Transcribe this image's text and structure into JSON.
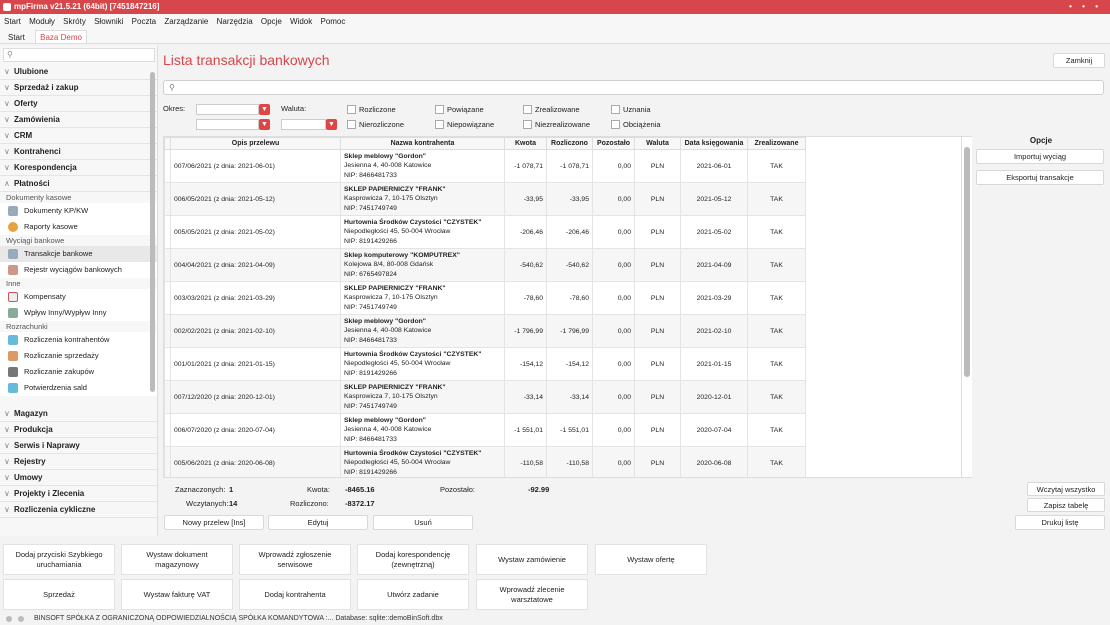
{
  "app": {
    "title": "mpFirma v21.5.21 (64bit) [7451847216]",
    "window_controls": "• • •"
  },
  "menu": [
    "Start",
    "Moduły",
    "Skróty",
    "Słowniki",
    "Poczta",
    "Zarządzanie",
    "Narzędzia",
    "Opcje",
    "Widok",
    "Pomoc"
  ],
  "tabs": [
    {
      "label": "Start"
    },
    {
      "label": "Baza Demo"
    }
  ],
  "sidebar": {
    "search_placeholder": "",
    "sections": [
      {
        "label": "Ulubione"
      },
      {
        "label": "Sprzedaż i zakup"
      },
      {
        "label": "Oferty"
      },
      {
        "label": "Zamówienia"
      },
      {
        "label": "CRM"
      },
      {
        "label": "Kontrahenci"
      },
      {
        "label": "Korespondencja"
      },
      {
        "label": "Płatności"
      }
    ],
    "groups": [
      {
        "label": "Dokumenty kasowe",
        "items": [
          "Dokumenty KP/KW",
          "Raporty kasowe"
        ]
      },
      {
        "label": "Wyciągi bankowe",
        "items": [
          "Transakcje bankowe",
          "Rejestr wyciągów bankowych"
        ]
      },
      {
        "label": "Inne",
        "items": [
          "Kompensaty",
          "Wpływ Inny/Wypływ Inny"
        ]
      },
      {
        "label": "Rozrachunki",
        "items": [
          "Rozliczenia kontrahentów",
          "Rozliczanie sprzedaży",
          "Rozliczanie zakupów",
          "Potwierdzenia sald"
        ]
      }
    ],
    "sections_bottom": [
      {
        "label": "Magazyn"
      },
      {
        "label": "Produkcja"
      },
      {
        "label": "Serwis i Naprawy"
      },
      {
        "label": "Rejestry"
      },
      {
        "label": "Umowy"
      },
      {
        "label": "Projekty i Zlecenia"
      },
      {
        "label": "Rozliczenia cykliczne"
      }
    ]
  },
  "page": {
    "title": "Lista transakcji bankowych",
    "close_label": "Zamknij",
    "search_placeholder": "",
    "filters": {
      "okres_label": "Okres:",
      "waluta_label": "Waluta:",
      "okres_from": "",
      "okres_to": "",
      "waluta_value": "",
      "waluta_value2": "",
      "checkboxes": [
        "Rozliczone",
        "Nierozliczone",
        "Powiązane",
        "Niepowiązane",
        "Zrealizowane",
        "Niezrealizowane",
        "Uznania",
        "Obciążenia"
      ]
    }
  },
  "table": {
    "columns": [
      "Opis przelewu",
      "Nazwa kontrahenta",
      "Kwota",
      "Rozliczono",
      "Pozostało",
      "Waluta",
      "Data księgowania",
      "Zrealizowane"
    ],
    "rows": [
      {
        "opis": "007/06/2021 (z dnia: 2021-06-01)",
        "name": "Sklep meblowy \"Gordon\"",
        "addr": "Jesienna 4, 40-008 Katowice",
        "nip": "NIP: 8466481733",
        "kwota": "-1 078,71",
        "rozl": "-1 078,71",
        "poz": "0,00",
        "waluta": "PLN",
        "data": "2021-06-01",
        "zreal": "TAK"
      },
      {
        "opis": "006/05/2021 (z dnia: 2021-05-12)",
        "name": "SKLEP PAPIERNICZY \"FRANK\"",
        "addr": "Kasprowicza 7, 10-175 Olsztyn",
        "nip": "NIP: 7451749749",
        "kwota": "-33,95",
        "rozl": "-33,95",
        "poz": "0,00",
        "waluta": "PLN",
        "data": "2021-05-12",
        "zreal": "TAK"
      },
      {
        "opis": "005/05/2021 (z dnia: 2021-05-02)",
        "name": "Hurtownia Środków Czystości \"CZYSTEK\"",
        "addr": "Niepodległości 45, 50-004 Wrocław",
        "nip": "NIP: 8191429266",
        "kwota": "-206,46",
        "rozl": "-206,46",
        "poz": "0,00",
        "waluta": "PLN",
        "data": "2021-05-02",
        "zreal": "TAK"
      },
      {
        "opis": "004/04/2021 (z dnia: 2021-04-09)",
        "name": "Sklep komputerowy \"KOMPUTREX\"",
        "addr": "Kolejowa 8/4, 80-008 Gdańsk",
        "nip": "NIP: 6765497824",
        "kwota": "-540,62",
        "rozl": "-540,62",
        "poz": "0,00",
        "waluta": "PLN",
        "data": "2021-04-09",
        "zreal": "TAK"
      },
      {
        "opis": "003/03/2021 (z dnia: 2021-03-29)",
        "name": "SKLEP PAPIERNICZY \"FRANK\"",
        "addr": "Kasprowicza 7, 10-175 Olsztyn",
        "nip": "NIP: 7451749749",
        "kwota": "-78,60",
        "rozl": "-78,60",
        "poz": "0,00",
        "waluta": "PLN",
        "data": "2021-03-29",
        "zreal": "TAK"
      },
      {
        "opis": "002/02/2021 (z dnia: 2021-02-10)",
        "name": "Sklep meblowy \"Gordon\"",
        "addr": "Jesienna 4, 40-008 Katowice",
        "nip": "NIP: 8466481733",
        "kwota": "-1 796,99",
        "rozl": "-1 796,99",
        "poz": "0,00",
        "waluta": "PLN",
        "data": "2021-02-10",
        "zreal": "TAK"
      },
      {
        "opis": "001/01/2021 (z dnia: 2021-01-15)",
        "name": "Hurtownia Środków Czystości \"CZYSTEK\"",
        "addr": "Niepodległości 45, 50-004 Wrocław",
        "nip": "NIP: 8191429266",
        "kwota": "-154,12",
        "rozl": "-154,12",
        "poz": "0,00",
        "waluta": "PLN",
        "data": "2021-01-15",
        "zreal": "TAK"
      },
      {
        "opis": "007/12/2020 (z dnia: 2020-12-01)",
        "name": "SKLEP PAPIERNICZY \"FRANK\"",
        "addr": "Kasprowicza 7, 10-175 Olsztyn",
        "nip": "NIP: 7451749749",
        "kwota": "-33,14",
        "rozl": "-33,14",
        "poz": "0,00",
        "waluta": "PLN",
        "data": "2020-12-01",
        "zreal": "TAK"
      },
      {
        "opis": "006/07/2020 (z dnia: 2020-07-04)",
        "name": "Sklep meblowy \"Gordon\"",
        "addr": "Jesienna 4, 40-008 Katowice",
        "nip": "NIP: 8466481733",
        "kwota": "-1 551,01",
        "rozl": "-1 551,01",
        "poz": "0,00",
        "waluta": "PLN",
        "data": "2020-07-04",
        "zreal": "TAK"
      },
      {
        "opis": "005/06/2021 (z dnia: 2020-06-08)",
        "name": "Hurtownia Środków Czystości \"CZYSTEK\"",
        "addr": "Niepodległości 45, 50-004 Wrocław",
        "nip": "NIP: 8191429266",
        "kwota": "-110,58",
        "rozl": "-110,58",
        "poz": "0,00",
        "waluta": "PLN",
        "data": "2020-06-08",
        "zreal": "TAK"
      }
    ]
  },
  "options": {
    "header": "Opcje",
    "buttons": [
      "Importuj wyciąg",
      "Eksportuj transakcje"
    ]
  },
  "summary": {
    "zaznaczonych_label": "Zaznaczonych:",
    "zaznaczonych": "1",
    "wczytanych_label": "Wczytanych:",
    "wczytanych": "14",
    "kwota_label": "Kwota:",
    "kwota": "-8465.16",
    "rozliczono_label": "Rozliczono:",
    "rozliczono": "-8372.17",
    "pozostalo_label": "Pozostało:",
    "pozostalo": "-92.99"
  },
  "actions": {
    "new": "Nowy przelew [Ins]",
    "edit": "Edytuj",
    "delete": "Usuń",
    "load_all": "Wczytaj wszystko",
    "save_table": "Zapisz tabelę",
    "print": "Drukuj listę"
  },
  "quick_buttons": [
    "Dodaj przyciski Szybkiego uruchamiania",
    "Wystaw dokument magazynowy",
    "Wprowadź zgłoszenie serwisowe",
    "Dodaj korespondencję (zewnętrzną)",
    "Wystaw zamówienie",
    "Wystaw ofertę",
    "Sprzedaż",
    "Wystaw fakturę VAT",
    "Dodaj kontrahenta",
    "Utwórz zadanie",
    "Wprowadź zlecenie warsztatowe"
  ],
  "status": {
    "text": "BINSOFT SPÓŁKA Z OGRANICZONĄ ODPOWIEDZIALNOŚCIĄ SPÓŁKA KOMANDYTOWA :... Database: sqlite::demoBinSoft.dbx"
  },
  "colors": {
    "accent": "#d7464a"
  }
}
